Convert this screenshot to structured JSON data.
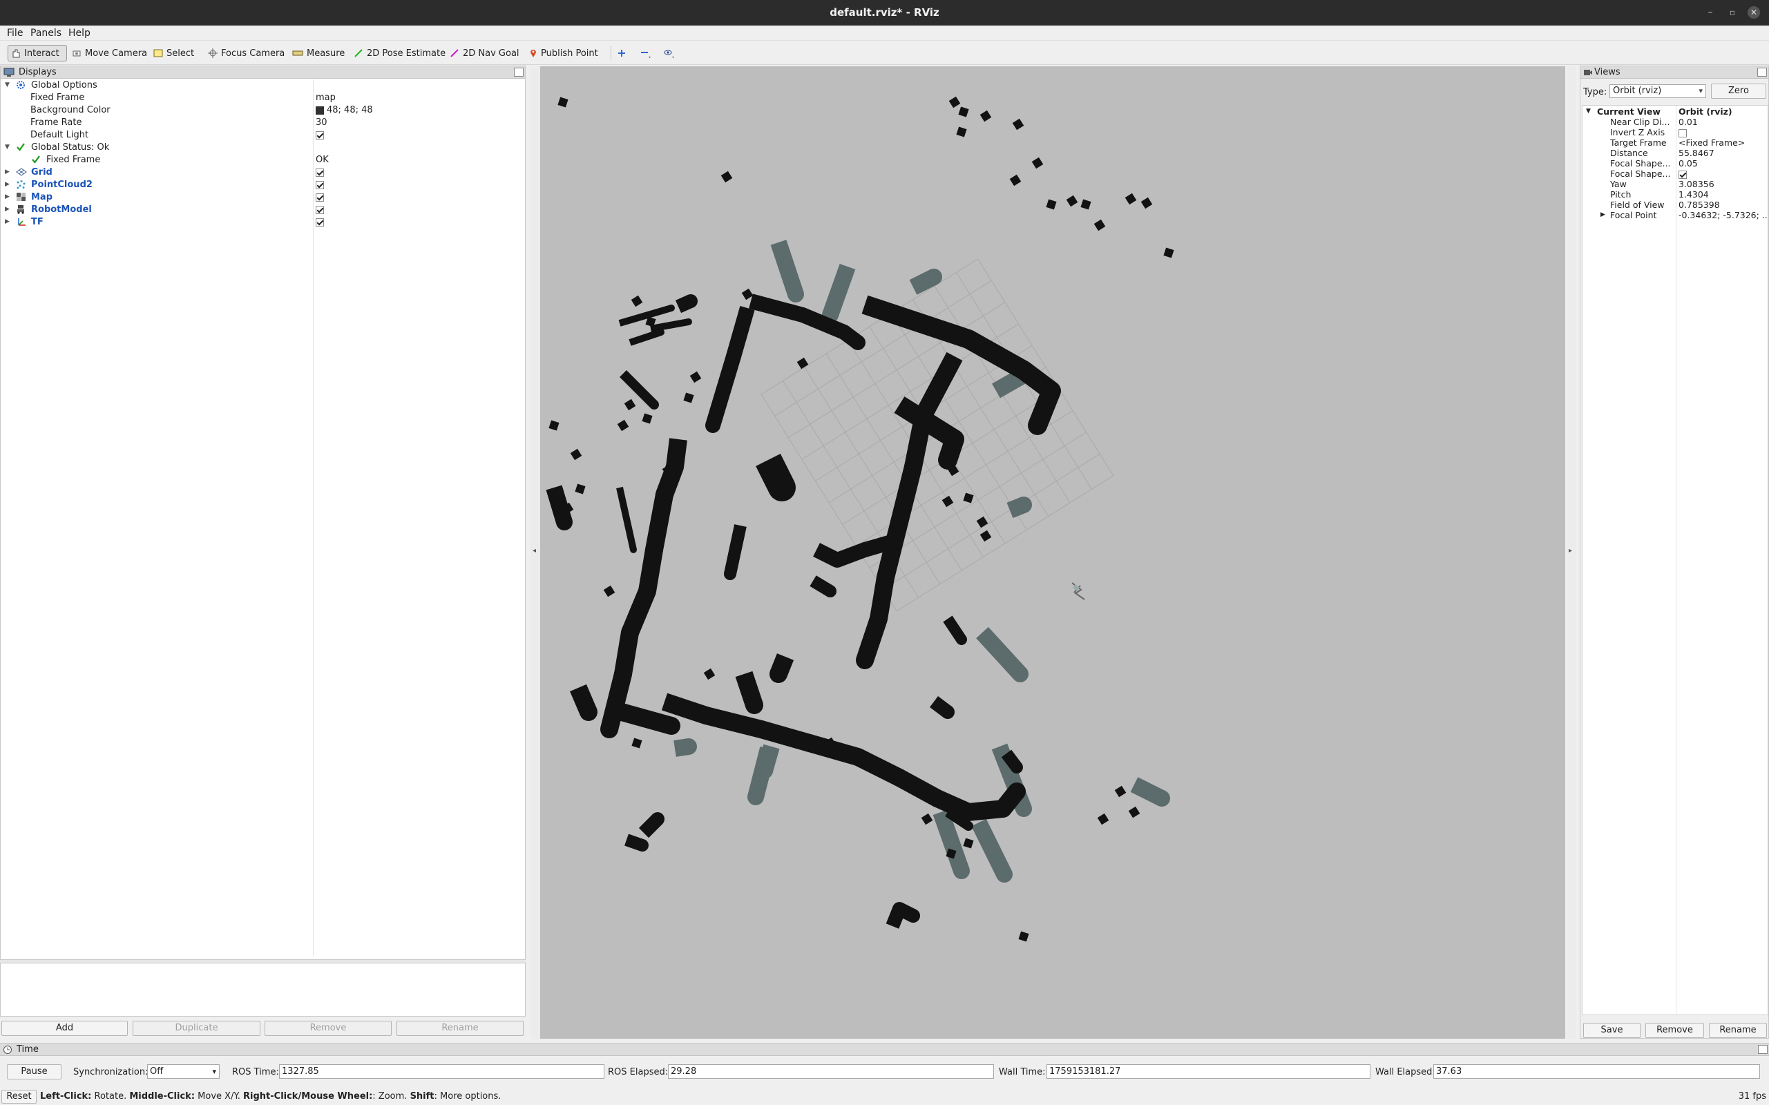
{
  "window": {
    "title": "default.rviz* - RViz"
  },
  "menu": [
    "File",
    "Panels",
    "Help"
  ],
  "toolbar": {
    "tools": [
      "Interact",
      "Move Camera",
      "Select",
      "Focus Camera",
      "Measure",
      "2D Pose Estimate",
      "2D Nav Goal",
      "Publish Point"
    ],
    "active_tool": "Interact"
  },
  "displays": {
    "title": "Displays",
    "global_options": "Global Options",
    "fixed_frame_label": "Fixed Frame",
    "fixed_frame_value": "map",
    "bg_color_label": "Background Color",
    "bg_color_value": "48; 48; 48",
    "frame_rate_label": "Frame Rate",
    "frame_rate_value": "30",
    "default_light_label": "Default Light",
    "global_status": "Global Status: Ok",
    "status_fixed_frame": "Fixed Frame",
    "status_fixed_frame_value": "OK",
    "items": [
      "Grid",
      "PointCloud2",
      "Map",
      "RobotModel",
      "TF"
    ],
    "buttons": {
      "add": "Add",
      "duplicate": "Duplicate",
      "remove": "Remove",
      "rename": "Rename"
    }
  },
  "views": {
    "title": "Views",
    "type_label": "Type:",
    "type_value": "Orbit (rviz)",
    "zero": "Zero",
    "current_view": "Current View",
    "current_view_type": "Orbit (rviz)",
    "props": [
      {
        "label": "Near Clip Di...",
        "value": "0.01"
      },
      {
        "label": "Invert Z Axis",
        "value": ""
      },
      {
        "label": "Target Frame",
        "value": "<Fixed Frame>"
      },
      {
        "label": "Distance",
        "value": "55.8467"
      },
      {
        "label": "Focal Shape...",
        "value": "0.05"
      },
      {
        "label": "Focal Shape...",
        "value": ""
      },
      {
        "label": "Yaw",
        "value": "3.08356"
      },
      {
        "label": "Pitch",
        "value": "1.4304"
      },
      {
        "label": "Field of View",
        "value": "0.785398"
      },
      {
        "label": "Focal Point",
        "value": "-0.34632; -5.7326; ..."
      }
    ],
    "buttons": {
      "save": "Save",
      "remove": "Remove",
      "rename": "Rename"
    }
  },
  "time": {
    "title": "Time",
    "pause": "Pause",
    "sync_label": "Synchronization:",
    "sync_value": "Off",
    "ros_time_label": "ROS Time:",
    "ros_time": "1327.85",
    "ros_elapsed_label": "ROS Elapsed:",
    "ros_elapsed": "29.28",
    "wall_time_label": "Wall Time:",
    "wall_time": "1759153181.27",
    "wall_elapsed_label": "Wall Elapsed:",
    "wall_elapsed": "37.63"
  },
  "status": {
    "reset": "Reset",
    "hint_1": "Left-Click:",
    "hint_2": " Rotate. ",
    "hint_3": "Middle-Click:",
    "hint_4": " Move X/Y. ",
    "hint_5": "Right-Click/Mouse Wheel:",
    "hint_6": ": Zoom. ",
    "hint_7": "Shift",
    "hint_8": ": More options.",
    "fps": "31 fps"
  },
  "colors": {
    "occupied": "#121212",
    "unknown": "#bdbdbd",
    "costmap": "#5c6b6b",
    "accent": "#1c54b7"
  }
}
